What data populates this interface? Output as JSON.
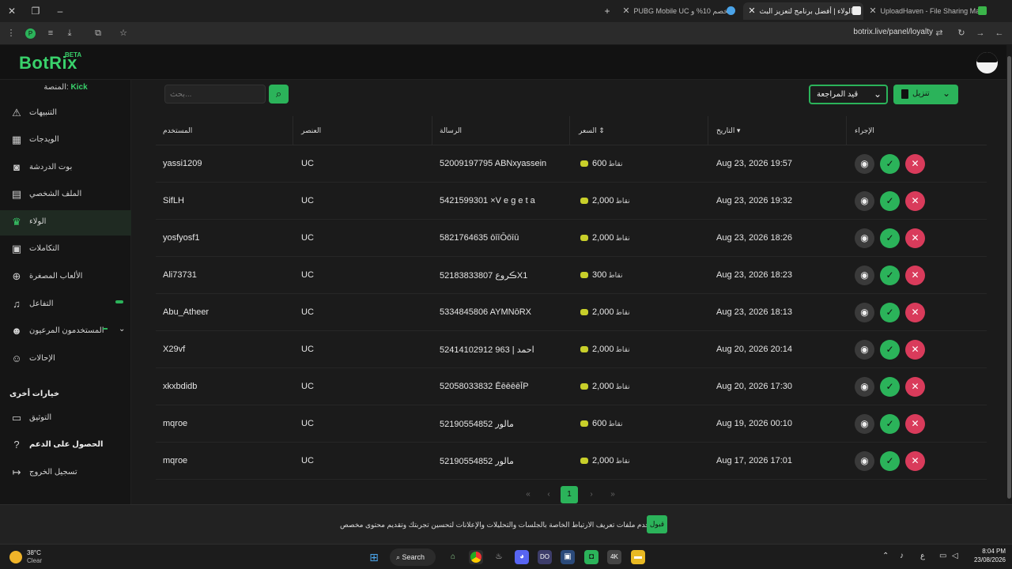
{
  "browser": {
    "tabs": [
      {
        "title": "UploadHaven - File Sharing Ma",
        "active": false
      },
      {
        "title": "الولاء | أفضل برنامج لتعزيز البث",
        "active": true
      },
      {
        "title": "PUBG Mobile UC بخصم 10% و",
        "active": false
      }
    ],
    "url": "botrix.live/panel/loyalty"
  },
  "app": {
    "logo": "BotRix",
    "beta": "BETA"
  },
  "sidebar": {
    "platform_label": "المنصة:",
    "platform_value": "Kick",
    "items": [
      {
        "label": "التنبيهات",
        "icon": "warning-icon"
      },
      {
        "label": "الويدجات",
        "icon": "widgets-icon"
      },
      {
        "label": "بوت الدردشة",
        "icon": "robot-icon"
      },
      {
        "label": "الملف الشخصي",
        "icon": "id-card-icon"
      },
      {
        "label": "الولاء",
        "icon": "trophy-icon",
        "active": true
      },
      {
        "label": "التكاملات",
        "icon": "integration-icon"
      },
      {
        "label": "الألعاب المصغرة",
        "icon": "gamepad-icon"
      },
      {
        "label": "التفاعل",
        "icon": "music-icon"
      },
      {
        "label": "المستخدمون المرعيون",
        "icon": "users-icon"
      },
      {
        "label": "الإحالات",
        "icon": "referrals-icon"
      }
    ],
    "other_header": "خيارات أخرى",
    "other_items": [
      {
        "label": "التوثيق",
        "icon": "docs-icon"
      },
      {
        "label": "الحصول على الدعم",
        "icon": "help-icon"
      },
      {
        "label": "تسجيل الخروج",
        "icon": "logout-icon"
      }
    ]
  },
  "toolbar": {
    "search_placeholder": "بحث...",
    "filter_value": "قيد المراجعة",
    "download_label": "تنزيل"
  },
  "table": {
    "headers": {
      "user": "المستخدم",
      "item": "العنصر",
      "message": "الرسالة",
      "price": "السعر",
      "date": "التاريخ",
      "action": "الإجراء"
    },
    "points_unit": "نقاط",
    "rows": [
      {
        "user": "yassi1209",
        "item": "UC",
        "message": "52009197795 ABNxyassein",
        "price": "600",
        "date": "Aug 23, 2026 19:57"
      },
      {
        "user": "SifLH",
        "item": "UC",
        "message": "5421599301 ×V e g e t a",
        "price": "2,000",
        "date": "Aug 23, 2026 19:32"
      },
      {
        "user": "yosfyosf1",
        "item": "UC",
        "message": "5821764635 ōīīŌōīū",
        "price": "2,000",
        "date": "Aug 23, 2026 18:26"
      },
      {
        "user": "Ali73731",
        "item": "UC",
        "message": "52183833807 ڪروعX1",
        "price": "300",
        "date": "Aug 23, 2026 18:23"
      },
      {
        "user": "Abu_Atheer",
        "item": "UC",
        "message": "5334845806 AYMNōRX",
        "price": "2,000",
        "date": "Aug 23, 2026 18:13"
      },
      {
        "user": "X29vf",
        "item": "UC",
        "message": "52414102912 963 | احمد",
        "price": "2,000",
        "date": "Aug 20, 2026 20:14"
      },
      {
        "user": "xkxbdidb",
        "item": "UC",
        "message": "52058033832 ĒēēēēĪP",
        "price": "2,000",
        "date": "Aug 20, 2026 17:30"
      },
      {
        "user": "mqroe",
        "item": "UC",
        "message": "52190554852 مالور",
        "price": "600",
        "date": "Aug 19, 2026 00:10"
      },
      {
        "user": "mqroe",
        "item": "UC",
        "message": "52190554852 مالور",
        "price": "2,000",
        "date": "Aug 17, 2026 17:01"
      }
    ]
  },
  "pagination": {
    "first": "«",
    "prev": "‹",
    "current": "1",
    "next": "›",
    "last": "»"
  },
  "cookie": {
    "text": "نستخدم ملفات تعريف الارتباط الخاصة بالجلسات والتحليلات والإعلانات لتحسين تجربتك وتقديم محتوى مخصص",
    "accept": "قبول"
  },
  "taskbar": {
    "temp": "38°C",
    "weather": "Clear",
    "search": "Search",
    "time": "8:04 PM",
    "date": "23/08/2026"
  },
  "colors": {
    "accent": "#2bb35a",
    "danger": "#d93b5b",
    "brand": "#39d16b"
  }
}
